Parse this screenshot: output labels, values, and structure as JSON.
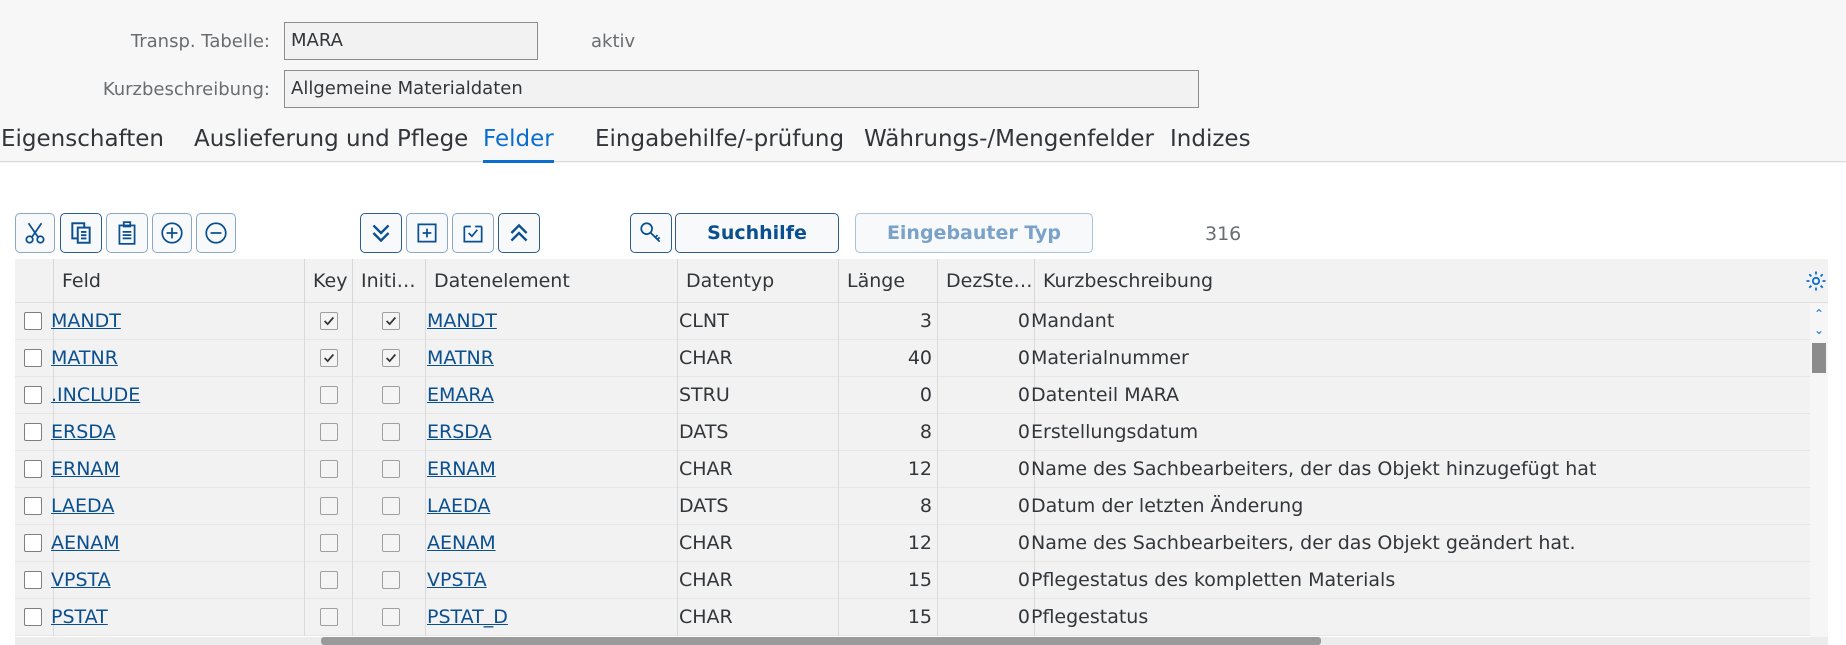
{
  "header": {
    "table_label": "Transp. Tabelle:",
    "table_value": "MARA",
    "status": "aktiv",
    "desc_label": "Kurzbeschreibung:",
    "desc_value": "Allgemeine Materialdaten"
  },
  "tabs": [
    {
      "label": "Eigenschaften",
      "active": false
    },
    {
      "label": "Auslieferung und Pflege",
      "active": false
    },
    {
      "label": "Felder",
      "active": true
    },
    {
      "label": "Eingabehilfe/-prüfung",
      "active": false
    },
    {
      "label": "Währungs-/Mengenfelder",
      "active": false
    },
    {
      "label": "Indizes",
      "active": false
    }
  ],
  "toolbar": {
    "cut_icon": "scissors-icon",
    "copy_icon": "copy-icon",
    "paste_icon": "clipboard-icon",
    "add_icon": "plus-circle-icon",
    "remove_icon": "minus-circle-icon",
    "search_help_label": "Suchhilfe",
    "builtin_type_label": "Eingebauter Typ",
    "row_count": "316"
  },
  "table": {
    "columns": [
      "Feld",
      "Key",
      "Initial...",
      "Datenelement",
      "Datentyp",
      "Länge",
      "DezStellen",
      "Kurzbeschreibung"
    ],
    "rows": [
      {
        "feld": "MANDT",
        "key": true,
        "initial": true,
        "element": "MANDT",
        "type": "CLNT",
        "length": "3",
        "dec": "0",
        "desc": "Mandant"
      },
      {
        "feld": "MATNR",
        "key": true,
        "initial": true,
        "element": "MATNR",
        "type": "CHAR",
        "length": "40",
        "dec": "0",
        "desc": "Materialnummer"
      },
      {
        "feld": ".INCLUDE",
        "key": false,
        "initial": false,
        "element": "EMARA",
        "type": "STRU",
        "length": "0",
        "dec": "0",
        "desc": "Datenteil MARA"
      },
      {
        "feld": "ERSDA",
        "key": false,
        "initial": false,
        "element": "ERSDA",
        "type": "DATS",
        "length": "8",
        "dec": "0",
        "desc": "Erstellungsdatum"
      },
      {
        "feld": "ERNAM",
        "key": false,
        "initial": false,
        "element": "ERNAM",
        "type": "CHAR",
        "length": "12",
        "dec": "0",
        "desc": "Name des Sachbearbeiters, der das Objekt hinzugefügt hat"
      },
      {
        "feld": "LAEDA",
        "key": false,
        "initial": false,
        "element": "LAEDA",
        "type": "DATS",
        "length": "8",
        "dec": "0",
        "desc": "Datum der letzten Änderung"
      },
      {
        "feld": "AENAM",
        "key": false,
        "initial": false,
        "element": "AENAM",
        "type": "CHAR",
        "length": "12",
        "dec": "0",
        "desc": "Name des Sachbearbeiters, der das Objekt geändert hat."
      },
      {
        "feld": "VPSTA",
        "key": false,
        "initial": false,
        "element": "VPSTA",
        "type": "CHAR",
        "length": "15",
        "dec": "0",
        "desc": "Pflegestatus des kompletten Materials"
      },
      {
        "feld": "PSTAT",
        "key": false,
        "initial": false,
        "element": "PSTAT_D",
        "type": "CHAR",
        "length": "15",
        "dec": "0",
        "desc": "Pflegestatus"
      }
    ]
  },
  "colors": {
    "accent": "#0a6ed1",
    "link": "#0a4f8f",
    "highlight": "#f0801e"
  }
}
